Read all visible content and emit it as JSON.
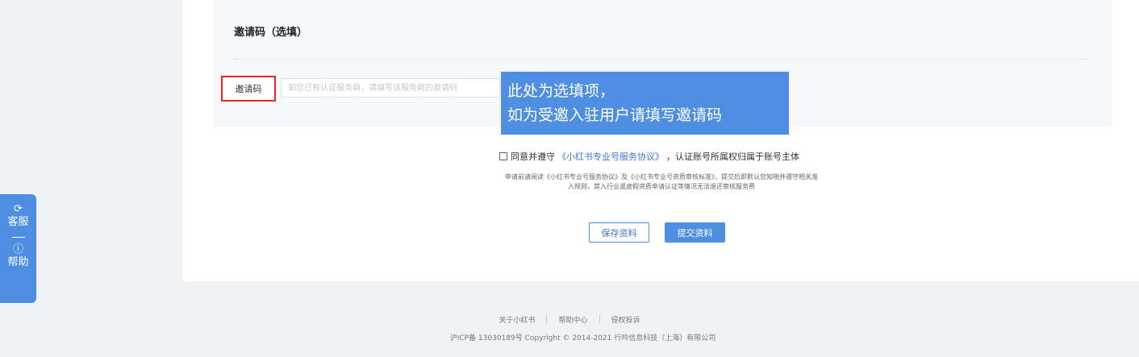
{
  "section": {
    "title": "邀请码（选填）"
  },
  "invite": {
    "label": "邀请码",
    "placeholder": "如您已有认证服务商，请填写该服务商的邀请码"
  },
  "tooltip": {
    "line1": "此处为选填项，",
    "line2": "如为受邀入驻用户请填写邀请码"
  },
  "agreement": {
    "prefix": "同意并遵守",
    "link": "《小红书专业号服务协议》",
    "suffix": "，认证账号所属权归属于账号主体"
  },
  "notice": {
    "line1": "申请前请阅读《小红书专业号服务协议》及《小红书专业号资质审核标准》，提交后即默认您知晓并遵守相关准",
    "line2": "入规则，禁入行业或虚假资质申请认证等情况无法退还审核服务费"
  },
  "buttons": {
    "save": "保存资料",
    "submit": "提交资料"
  },
  "footer": {
    "about": "关于小红书",
    "help": "帮助中心",
    "report": "侵权投诉",
    "copyright": "沪ICP备 13030189号 Copyright © 2014-2021 行吟信息科技（上海）有限公司"
  },
  "side": {
    "service_icon": "headset-icon",
    "service": "客服",
    "help_icon": "question-circle-icon",
    "help": "帮助"
  },
  "colors": {
    "accent": "#4f8fe3",
    "highlight_border": "#e8272b"
  }
}
